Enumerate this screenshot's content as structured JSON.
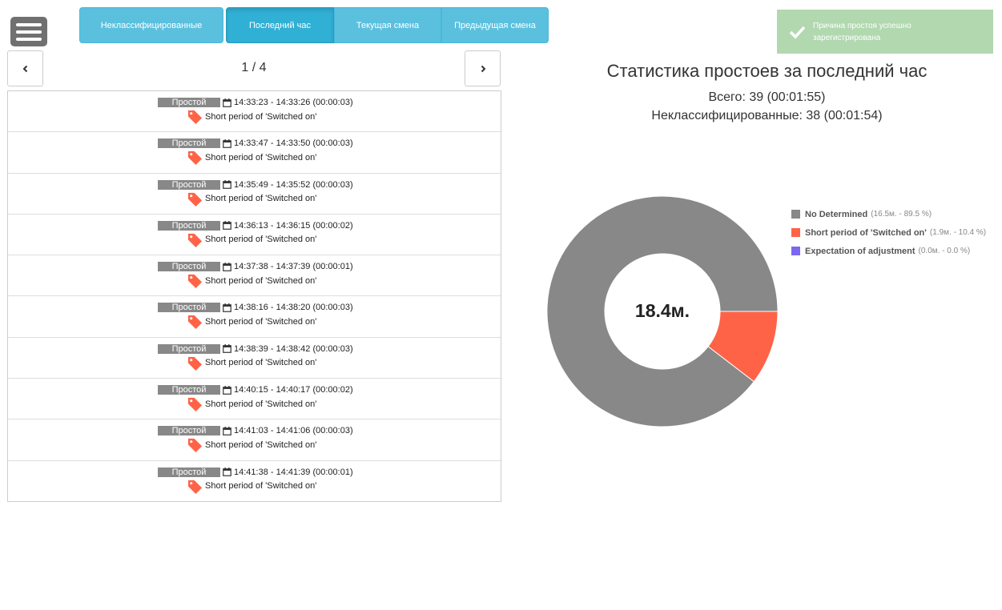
{
  "tabs": [
    {
      "label": "Неклассифицированные"
    },
    {
      "label": "Последний час"
    },
    {
      "label": "Текущая смена"
    },
    {
      "label": "Предыдущая смена"
    }
  ],
  "pager": {
    "indicator": "1 / 4"
  },
  "events": [
    {
      "type": "Простой",
      "time": "14:33:23 - 14:33:26 (00:00:03)",
      "reason": "Short period of 'Switched on'"
    },
    {
      "type": "Простой",
      "time": "14:33:47 - 14:33:50 (00:00:03)",
      "reason": "Short period of 'Switched on'"
    },
    {
      "type": "Простой",
      "time": "14:35:49 - 14:35:52 (00:00:03)",
      "reason": "Short period of 'Switched on'"
    },
    {
      "type": "Простой",
      "time": "14:36:13 - 14:36:15 (00:00:02)",
      "reason": "Short period of 'Switched on'"
    },
    {
      "type": "Простой",
      "time": "14:37:38 - 14:37:39 (00:00:01)",
      "reason": "Short period of 'Switched on'"
    },
    {
      "type": "Простой",
      "time": "14:38:16 - 14:38:20 (00:00:03)",
      "reason": "Short period of 'Switched on'"
    },
    {
      "type": "Простой",
      "time": "14:38:39 - 14:38:42 (00:00:03)",
      "reason": "Short period of 'Switched on'"
    },
    {
      "type": "Простой",
      "time": "14:40:15 - 14:40:17 (00:00:02)",
      "reason": "Short period of 'Switched on'"
    },
    {
      "type": "Простой",
      "time": "14:41:03 - 14:41:06 (00:00:03)",
      "reason": "Short period of 'Switched on'"
    },
    {
      "type": "Простой",
      "time": "14:41:38 - 14:41:39 (00:00:01)",
      "reason": "Short period of 'Switched on'"
    }
  ],
  "toast": {
    "message": "Причина простоя успешно зарегистрирована"
  },
  "stats": {
    "title": "Статистика простоев за последний час",
    "total": "Всего: 39 (00:01:55)",
    "unclassified": "Неклассифицированные: 38 (00:01:54)"
  },
  "chart_data": {
    "type": "pie",
    "center_label": "18.4м.",
    "series": [
      {
        "name": "No Determined",
        "value": 16.5,
        "percent": 89.5,
        "detail": "(16.5м. - 89.5 %)",
        "color": "#888888"
      },
      {
        "name": "Short period of 'Switched on'",
        "value": 1.9,
        "percent": 10.4,
        "detail": "(1.9м. - 10.4 %)",
        "color": "#ff6347"
      },
      {
        "name": "Expectation of adjustment",
        "value": 0.0,
        "percent": 0.0,
        "detail": "(0.0м. - 0.0 %)",
        "color": "#7b68ee"
      }
    ],
    "legend": "right"
  },
  "colors": {
    "tab": "#5bc0de",
    "tab_active": "#31b0d5",
    "badge": "#888888",
    "toast": "#b2d8b0"
  },
  "icons": {
    "menu": "hamburger-icon",
    "prev": "chevron-left-icon",
    "next": "chevron-right-icon",
    "calendar": "calendar-icon",
    "tag": "tag-icon",
    "check": "check-icon"
  }
}
